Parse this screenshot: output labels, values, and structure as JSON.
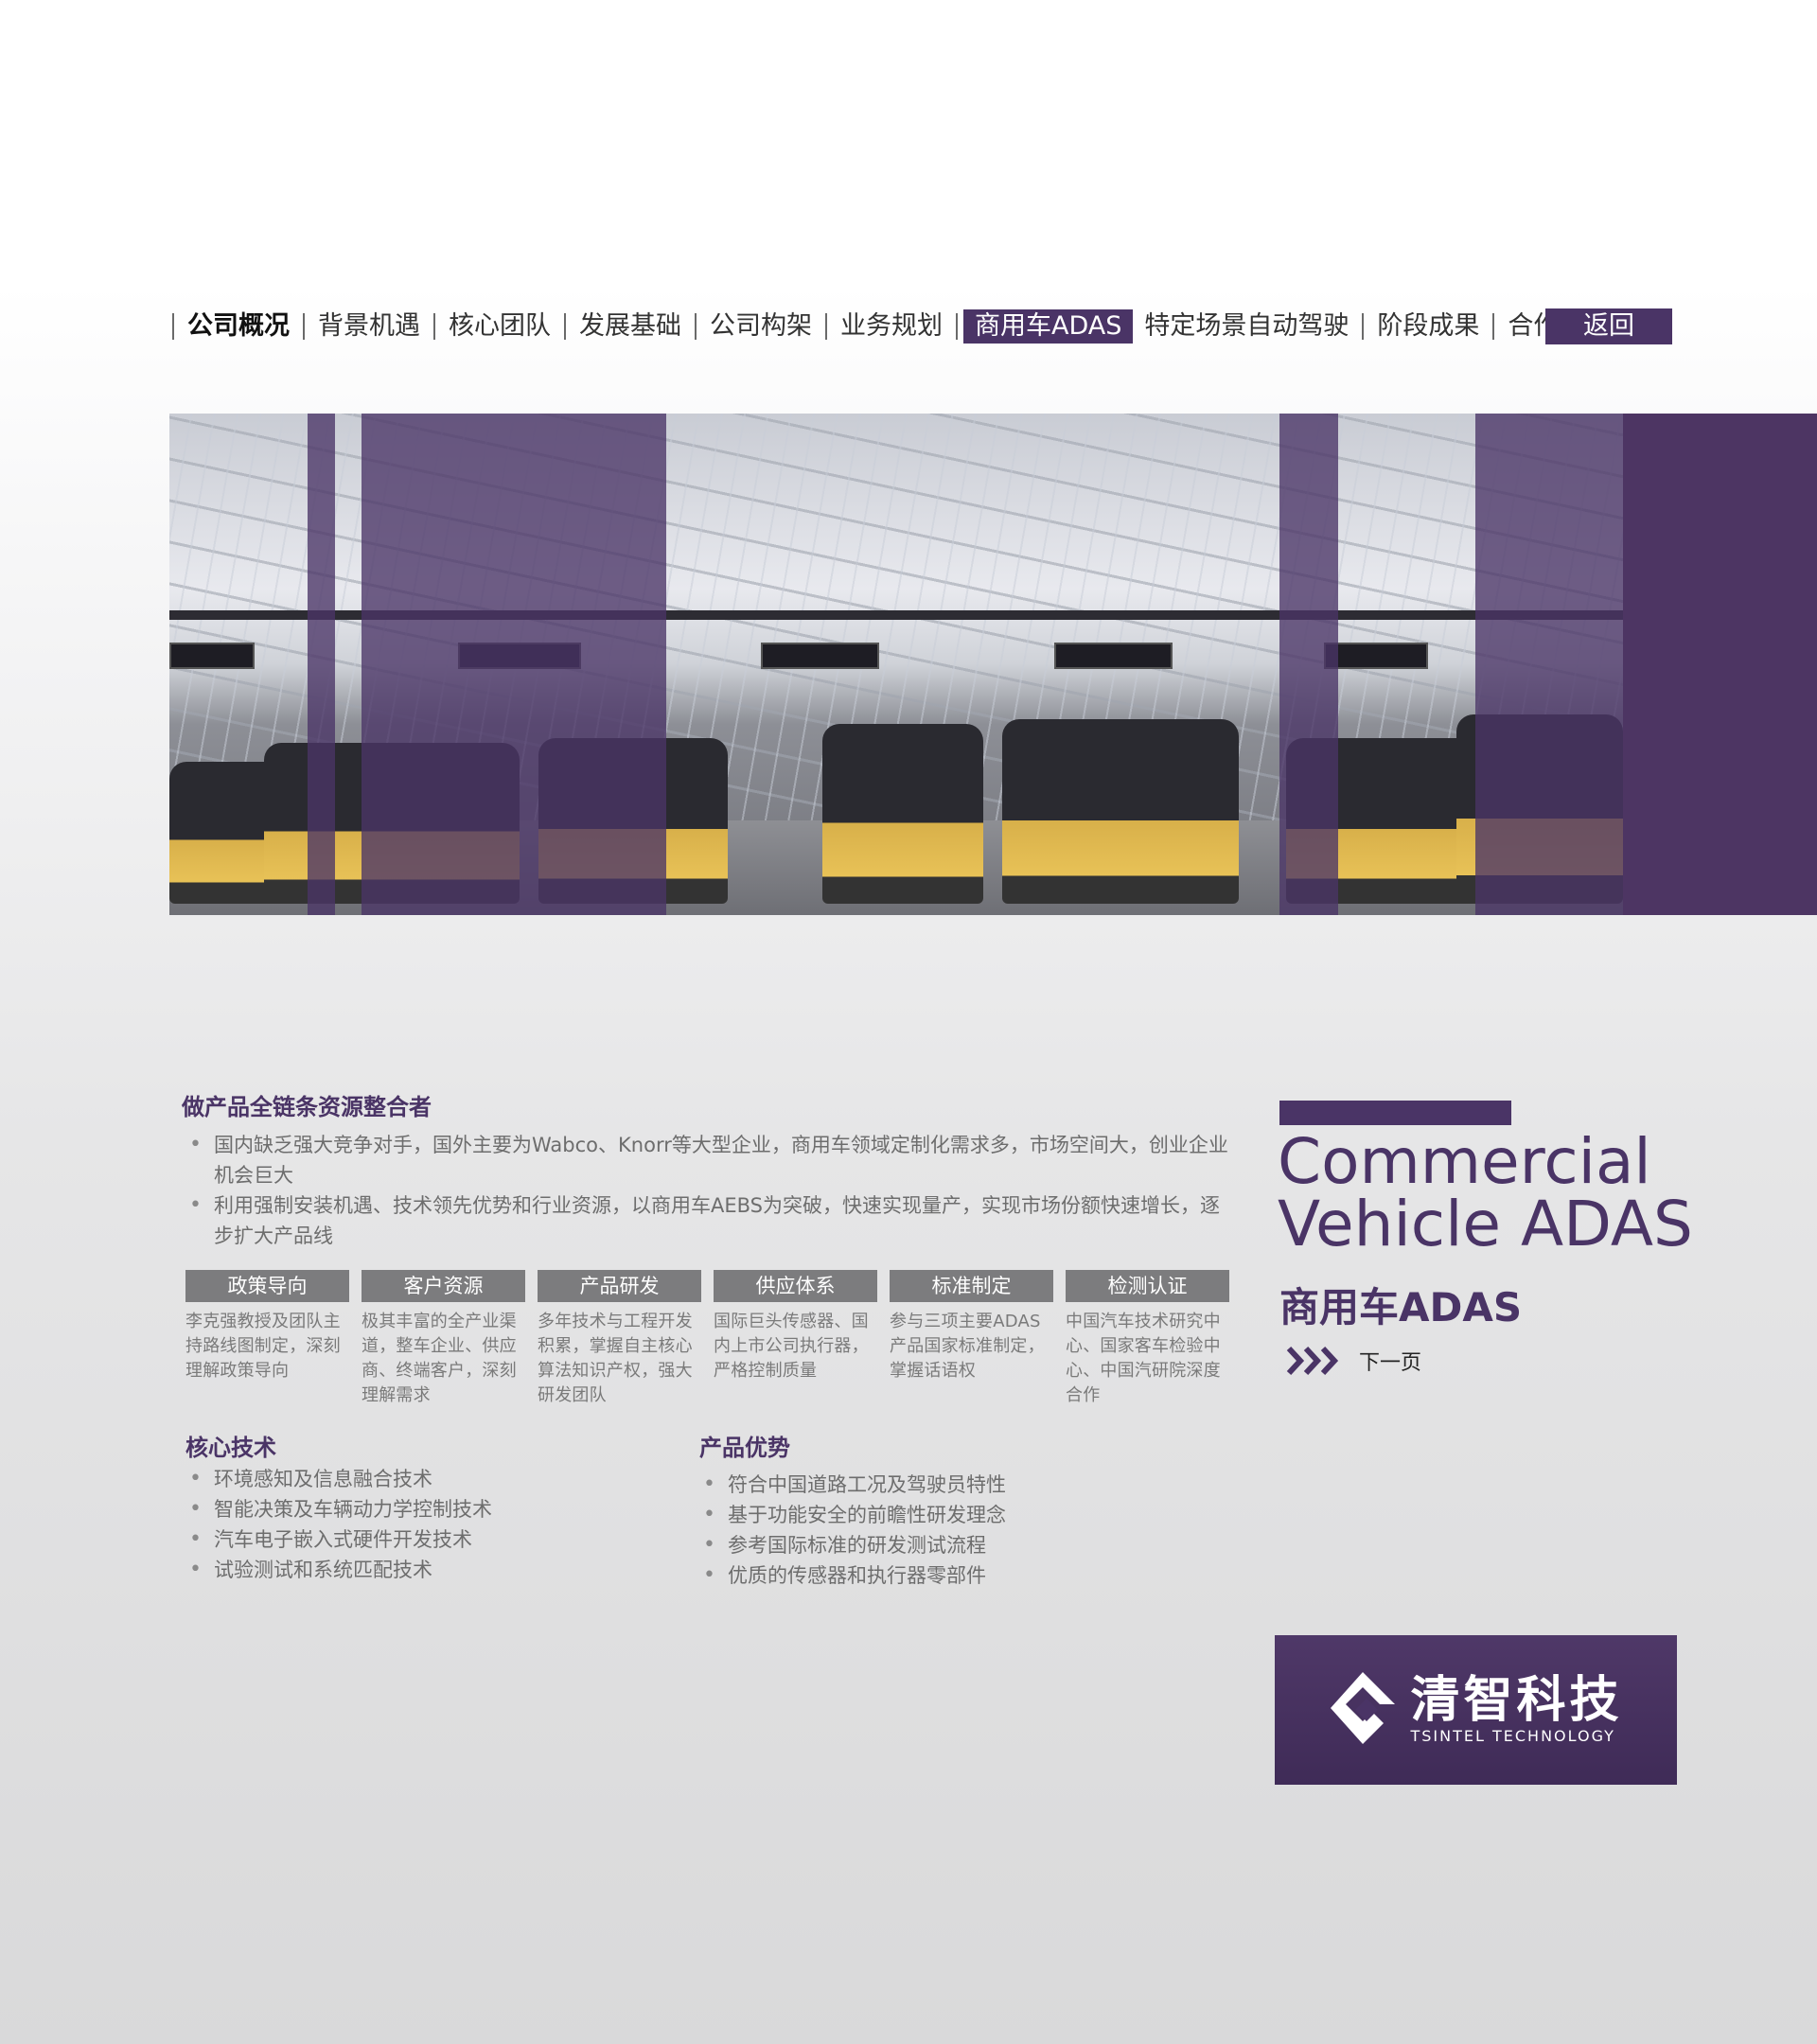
{
  "nav": {
    "items": [
      {
        "label": "公司概况"
      },
      {
        "label": "背景机遇"
      },
      {
        "label": "核心团队"
      },
      {
        "label": "发展基础"
      },
      {
        "label": "公司构架"
      },
      {
        "label": "业务规划"
      },
      {
        "label": "商用车ADAS",
        "active": true
      },
      {
        "label": "特定场景自动驾驶"
      },
      {
        "label": "阶段成果"
      },
      {
        "label": "合作伙伴"
      }
    ],
    "back_label": "返回"
  },
  "section1": {
    "title": "做产品全链条资源整合者",
    "bullets": [
      "国内缺乏强大竞争对手，国外主要为Wabco、Knorr等大型企业，商用车领域定制化需求多，市场空间大，创业企业机会巨大",
      "利用强制安装机遇、技术领先优势和行业资源，以商用车AEBS为突破，快速实现量产，实现市场份额快速增长，逐步扩大产品线"
    ]
  },
  "pillars": [
    {
      "head": "政策导向",
      "desc": "李克强教授及团队主持路线图制定，深刻理解政策导向"
    },
    {
      "head": "客户资源",
      "desc": "极其丰富的全产业渠道，整车企业、供应商、终端客户，深刻理解需求"
    },
    {
      "head": "产品研发",
      "desc": "多年技术与工程开发积累，掌握自主核心算法知识产权，强大研发团队"
    },
    {
      "head": "供应体系",
      "desc": "国际巨头传感器、国内上市公司执行器，严格控制质量"
    },
    {
      "head": "标准制定",
      "desc": "参与三项主要ADAS产品国家标准制定，掌握话语权"
    },
    {
      "head": "检测认证",
      "desc": "中国汽车技术研究中心、国家客车检验中心、中国汽研院深度合作"
    }
  ],
  "core_tech": {
    "title": "核心技术",
    "items": [
      "环境感知及信息融合技术",
      "智能决策及车辆动力学控制技术",
      "汽车电子嵌入式硬件开发技术",
      "试验测试和系统匹配技术"
    ]
  },
  "advantages": {
    "title": "产品优势",
    "items": [
      "符合中国道路工况及驾驶员特性",
      "基于功能安全的前瞻性研发理念",
      "参考国际标准的研发测试流程",
      "优质的传感器和执行器零部件"
    ]
  },
  "side": {
    "en_line1": "Commercial",
    "en_line2": "Vehicle ADAS",
    "cn_title": "商用车ADAS",
    "next_label": "下一页"
  },
  "logo": {
    "cn": "清智科技",
    "en": "TSINTEL TECHNOLOGY"
  },
  "colors": {
    "accent": "#4a3466",
    "pillar_head": "#7c7c7e",
    "body_text": "#6d6d6d"
  }
}
